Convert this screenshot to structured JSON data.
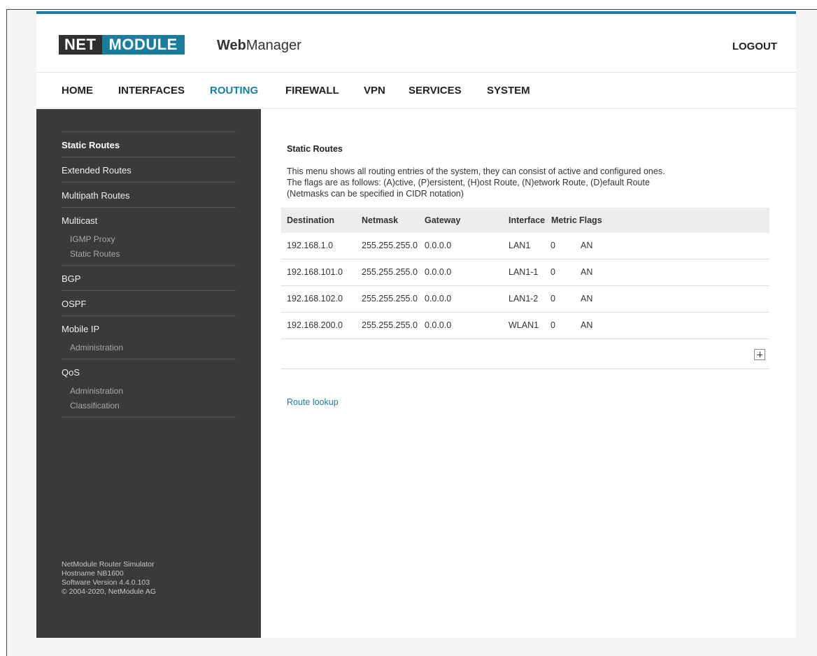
{
  "header": {
    "logo_left": "NET",
    "logo_right": "MODULE",
    "app_name_bold": "Web",
    "app_name_rest": "Manager",
    "logout_label": "LOGOUT"
  },
  "nav": {
    "items": [
      "HOME",
      "INTERFACES",
      "ROUTING",
      "FIREWALL",
      "VPN",
      "SERVICES",
      "SYSTEM"
    ],
    "active": "ROUTING"
  },
  "sidebar": {
    "static_routes": "Static Routes",
    "extended_routes": "Extended Routes",
    "multipath_routes": "Multipath Routes",
    "multicast": "Multicast",
    "multicast_igmp": "IGMP Proxy",
    "multicast_static": "Static Routes",
    "bgp": "BGP",
    "ospf": "OSPF",
    "mobile_ip": "Mobile IP",
    "mobile_ip_admin": "Administration",
    "qos": "QoS",
    "qos_admin": "Administration",
    "qos_class": "Classification"
  },
  "footer": {
    "line1": "NetModule Router Simulator",
    "line2": "Hostname NB1600",
    "line3": "Software Version 4.4.0.103",
    "line4": "© 2004-2020, NetModule AG"
  },
  "main": {
    "title": "Static Routes",
    "desc1": "This menu shows all routing entries of the system, they can consist of active and configured ones.",
    "desc2": "The flags are as follows: (A)ctive, (P)ersistent, (H)ost Route, (N)etwork Route, (D)efault Route",
    "desc3": "(Netmasks can be specified in CIDR notation)",
    "columns": [
      "Destination",
      "Netmask",
      "Gateway",
      "Interface",
      "Metric",
      "Flags"
    ],
    "rows": [
      [
        "192.168.1.0",
        "255.255.255.0",
        "0.0.0.0",
        "LAN1",
        "0",
        "AN"
      ],
      [
        "192.168.101.0",
        "255.255.255.0",
        "0.0.0.0",
        "LAN1-1",
        "0",
        "AN"
      ],
      [
        "192.168.102.0",
        "255.255.255.0",
        "0.0.0.0",
        "LAN1-2",
        "0",
        "AN"
      ],
      [
        "192.168.200.0",
        "255.255.255.0",
        "0.0.0.0",
        "WLAN1",
        "0",
        "AN"
      ]
    ],
    "route_lookup": "Route lookup"
  },
  "colors": {
    "accent": "#1b7d9e",
    "sidebar_bg": "#3a3a3a",
    "logo_dark": "#2f2f2f"
  }
}
